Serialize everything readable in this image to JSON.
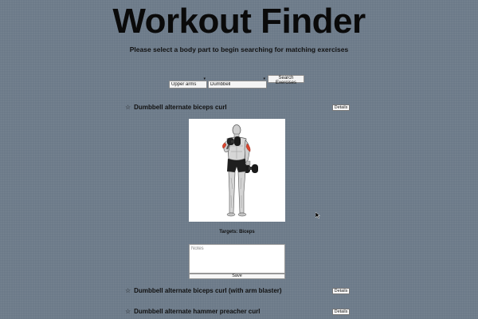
{
  "header": {
    "title": "Workout Finder",
    "subtitle": "Please select a body part to begin searching for matching exercises"
  },
  "search": {
    "body_part": "Upper arms",
    "equipment": "Dumbbell",
    "button_label": "Search Exercises"
  },
  "results": [
    {
      "name": "Dumbbell alternate biceps curl",
      "star": "☆",
      "details_label": "Details",
      "targets": "Targets: Biceps",
      "notes_placeholder": "Notes",
      "save_label": "Save"
    },
    {
      "name": "Dumbbell alternate biceps curl (with arm blaster)",
      "star": "☆",
      "details_label": "Details"
    },
    {
      "name": "Dumbbell alternate hammer preacher curl",
      "star": "☆",
      "details_label": "Details"
    }
  ],
  "icons": {
    "star": "star-outline-icon",
    "cursor": "mouse-cursor-icon",
    "caret": "chevron-down-icon"
  },
  "colors": {
    "background": "#6c7a89",
    "muscle_highlight": "#d9452e"
  }
}
